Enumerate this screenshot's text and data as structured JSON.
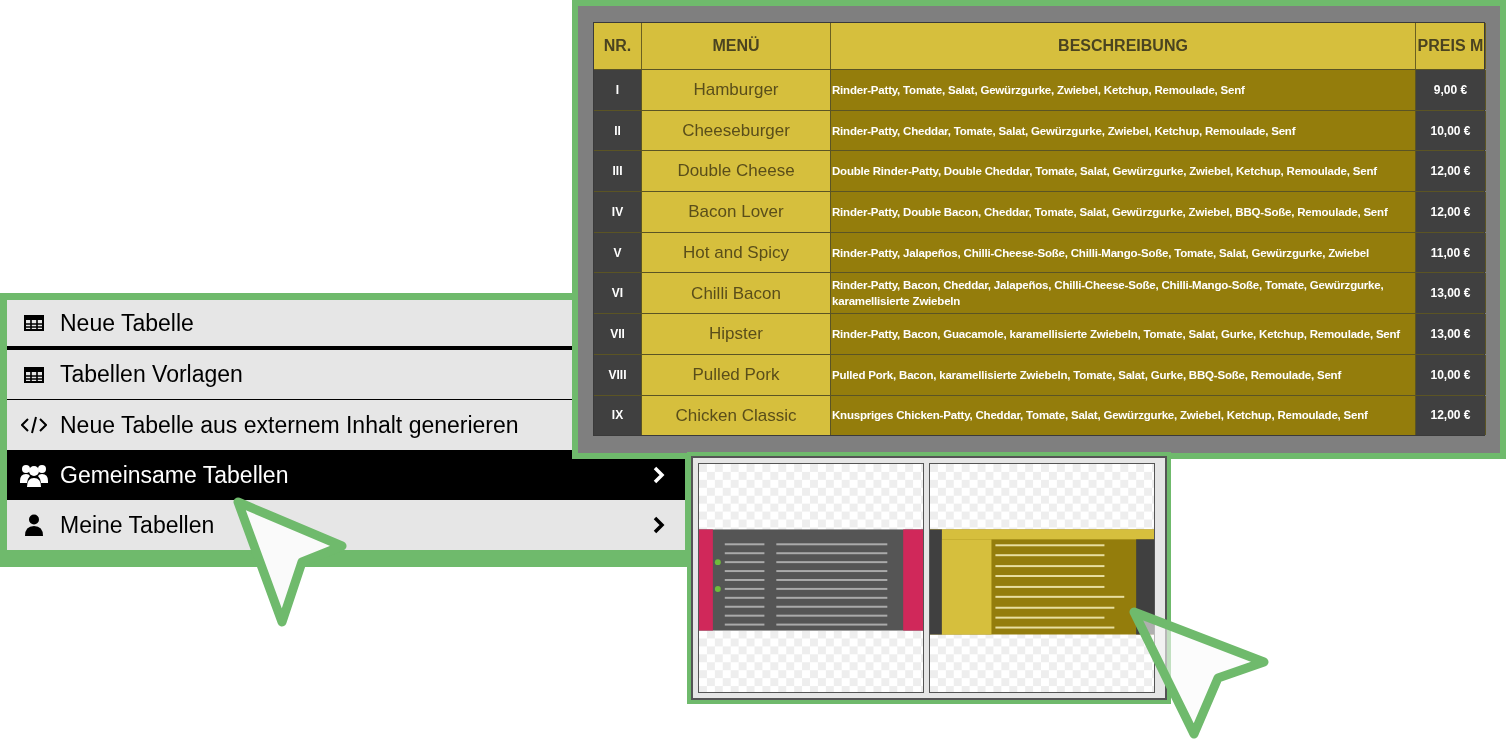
{
  "price_table": {
    "columns": [
      "NR.",
      "MENÜ",
      "BESCHREIBUNG",
      "PREIS M"
    ],
    "rows": [
      {
        "nr": "I",
        "menu": "Hamburger",
        "description": "Rinder-Patty, Tomate, Salat, Gewürzgurke, Zwiebel, Ketchup, Remoulade, Senf",
        "price": "9,00 €"
      },
      {
        "nr": "II",
        "menu": "Cheeseburger",
        "description": "Rinder-Patty, Cheddar, Tomate, Salat, Gewürzgurke, Zwiebel, Ketchup, Remoulade, Senf",
        "price": "10,00 €"
      },
      {
        "nr": "III",
        "menu": "Double Cheese",
        "description": "Double Rinder-Patty, Double Cheddar, Tomate, Salat, Gewürzgurke, Zwiebel, Ketchup, Remoulade, Senf",
        "price": "12,00 €"
      },
      {
        "nr": "IV",
        "menu": "Bacon Lover",
        "description": "Rinder-Patty, Double Bacon, Cheddar, Tomate, Salat, Gewürzgurke, Zwiebel, BBQ-Soße, Remoulade, Senf",
        "price": "12,00 €"
      },
      {
        "nr": "V",
        "menu": "Hot and Spicy",
        "description": "Rinder-Patty, Jalapeños, Chilli-Cheese-Soße, Chilli-Mango-Soße, Tomate, Salat, Gewürzgurke, Zwiebel",
        "price": "11,00 €"
      },
      {
        "nr": "VI",
        "menu": "Chilli Bacon",
        "description": "Rinder-Patty, Bacon, Cheddar, Jalapeños, Chilli-Cheese-Soße, Chilli-Mango-Soße, Tomate, Gewürzgurke, karamellisierte Zwiebeln",
        "price": "13,00 €"
      },
      {
        "nr": "VII",
        "menu": "Hipster",
        "description": "Rinder-Patty, Bacon, Guacamole, karamellisierte Zwiebeln, Tomate, Salat, Gurke, Ketchup, Remoulade, Senf",
        "price": "13,00 €"
      },
      {
        "nr": "VIII",
        "menu": "Pulled Pork",
        "description": "Pulled Pork, Bacon, karamellisierte Zwiebeln, Tomate, Salat, Gurke, BBQ-Soße, Remoulade, Senf",
        "price": "10,00 €"
      },
      {
        "nr": "IX",
        "menu": "Chicken Classic",
        "description": "Knuspriges Chicken-Patty, Cheddar, Tomate, Salat, Gewürzgurke, Zwiebel, Ketchup, Remoulade, Senf",
        "price": "12,00 €"
      }
    ]
  },
  "menu": {
    "items": [
      {
        "kind": "table",
        "label": "Neue Tabelle",
        "selected": false,
        "submenu": false
      },
      {
        "kind": "table",
        "label": "Tabellen Vorlagen",
        "selected": false,
        "submenu": false
      },
      {
        "kind": "code",
        "label": "Neue Tabelle aus externem Inhalt generieren",
        "selected": false,
        "submenu": false
      },
      {
        "kind": "users",
        "label": "Gemeinsame Tabellen",
        "selected": true,
        "submenu": true
      },
      {
        "kind": "user",
        "label": "Meine Tabellen",
        "selected": false,
        "submenu": true
      }
    ]
  }
}
